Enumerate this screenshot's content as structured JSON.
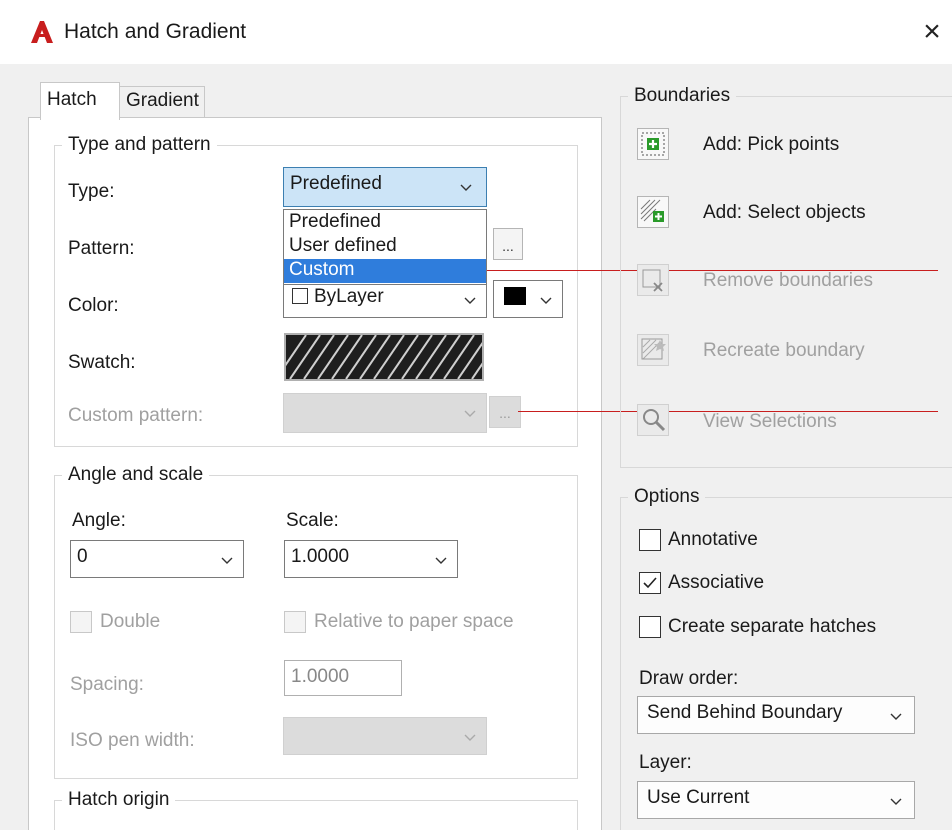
{
  "window": {
    "title": "Hatch and Gradient",
    "close_symbol": "×"
  },
  "tabs": [
    {
      "label": "Hatch",
      "active": true
    },
    {
      "label": "Gradient",
      "active": false
    }
  ],
  "type_and_pattern": {
    "group_label": "Type and pattern",
    "type_label": "Type:",
    "type_value": "Predefined",
    "type_options": [
      "Predefined",
      "User defined",
      "Custom"
    ],
    "type_highlighted_option": "Custom",
    "pattern_label": "Pattern:",
    "pattern_button": "...",
    "color_label": "Color:",
    "color_value": "ByLayer",
    "swatch_label": "Swatch:",
    "custom_pattern_label": "Custom pattern:",
    "custom_pattern_button": "..."
  },
  "angle_and_scale": {
    "group_label": "Angle and scale",
    "angle_label": "Angle:",
    "angle_value": "0",
    "scale_label": "Scale:",
    "scale_value": "1.0000",
    "double_label": "Double",
    "relative_label": "Relative to paper space",
    "spacing_label": "Spacing:",
    "spacing_value": "1.0000",
    "iso_label": "ISO pen width:"
  },
  "hatch_origin": {
    "group_label": "Hatch origin"
  },
  "boundaries": {
    "group_label": "Boundaries",
    "items": [
      {
        "label": "Add: Pick points",
        "enabled": true,
        "icon": "pick-points-icon"
      },
      {
        "label": "Add: Select objects",
        "enabled": true,
        "icon": "select-objects-icon"
      },
      {
        "label": "Remove boundaries",
        "enabled": false,
        "icon": "remove-boundaries-icon"
      },
      {
        "label": "Recreate boundary",
        "enabled": false,
        "icon": "recreate-boundary-icon"
      },
      {
        "label": "View Selections",
        "enabled": false,
        "icon": "magnifier-icon"
      }
    ]
  },
  "options": {
    "group_label": "Options",
    "annotative_label": "Annotative",
    "annotative_checked": false,
    "associative_label": "Associative",
    "associative_checked": true,
    "separate_label": "Create separate hatches",
    "separate_checked": false,
    "draw_order_label": "Draw order:",
    "draw_order_value": "Send Behind Boundary",
    "layer_label": "Layer:",
    "layer_value": "Use Current"
  },
  "colors": {
    "accent_red": "#c81e1e",
    "selection_blue": "#2f7ddc",
    "focused_combo": "#cce4f7",
    "plus_green": "#2a9a2a"
  }
}
